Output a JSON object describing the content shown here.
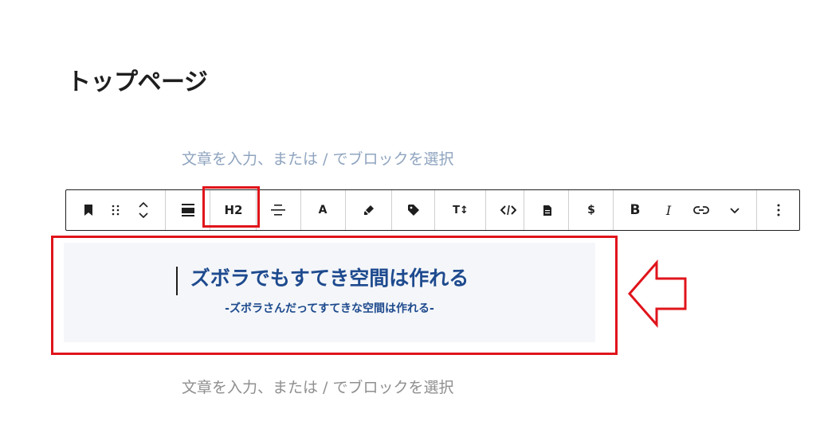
{
  "page": {
    "title": "トップページ"
  },
  "editor": {
    "placeholder_top": "文章を入力、または / でブロックを選択",
    "placeholder_bottom": "文章を入力、または / でブロックを選択"
  },
  "toolbar": {
    "heading_level_label": "H2",
    "text_color_label": "A",
    "font_size_label": "T↕",
    "currency_label": "$",
    "bold_label": "B",
    "italic_label": "I",
    "icons": [
      "bookmark-icon",
      "drag-handle-icon",
      "move-up-down-icon",
      "align-icon",
      "heading-level-button",
      "text-align-icon",
      "text-color-button",
      "highlighter-icon",
      "tag-icon",
      "font-size-button",
      "code-icon",
      "document-icon",
      "currency-button",
      "bold-button",
      "italic-button",
      "link-icon",
      "chevron-down-icon",
      "more-options-icon"
    ]
  },
  "heading_block": {
    "main_text": "ズボラでもすてき空間は作れる",
    "sub_text": "-ズボラさんだってすてきな空間は作れる-"
  },
  "annotations": {
    "highlight_color": "#e0141b",
    "heading_color": "#1e4a8e"
  }
}
